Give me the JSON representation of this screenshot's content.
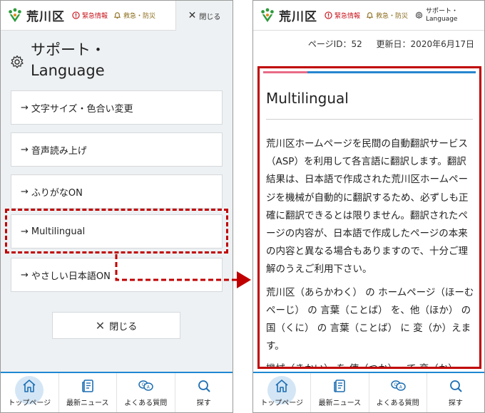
{
  "header": {
    "logo_text": "荒川区",
    "emergency_label": "緊急情報",
    "rescue_label": "救急・防災",
    "close_label": "閉じる",
    "support_line1": "サポート・",
    "support_line2": "Language"
  },
  "menu": {
    "title_line1": "サポート・",
    "title_line2": "Language",
    "items": [
      {
        "label": "文字サイズ・色合い変更"
      },
      {
        "label": "音声読み上げ"
      },
      {
        "label": "ふりがなON"
      },
      {
        "label": "Multilingual"
      },
      {
        "label": "やさしい日本語ON"
      }
    ],
    "close_button": "閉じる"
  },
  "nav": {
    "items": [
      {
        "label": "トップページ",
        "icon": "home-icon"
      },
      {
        "label": "最新ニュース",
        "icon": "news-icon"
      },
      {
        "label": "よくある質問",
        "icon": "faq-icon"
      },
      {
        "label": "探す",
        "icon": "search-icon"
      }
    ]
  },
  "page_info": {
    "page_id": "ページID：52",
    "updated": "更新日：2020年6月17日"
  },
  "content": {
    "title": "Multilingual",
    "para1": "荒川区ホームページを民間の自動翻訳サービス（ASP）を利用して各言語に翻訳します。翻訳結果は、日本語で作成された荒川区ホームページを機械が自動的に翻訳するため、必ずしも正確に翻訳できるとは限りません。翻訳されたページの内容が、日本語で作成したページの本来の内容と異なる場合もありますので、十分ご理解のうえご利用下さい。",
    "para2": "荒川区（あらかわく） の ホームページ（ほーむぺーじ） の 言葉（ことば） を、他（ほか） の 国（くに） の 言葉（ことば） に 変（か）えます。",
    "para3": "機械（きかい） を 使（つか）って 変（か）"
  },
  "colors": {
    "accent_red": "#c00000",
    "accent_blue": "#1e88d2",
    "logo_green": "#2e9b3b"
  }
}
